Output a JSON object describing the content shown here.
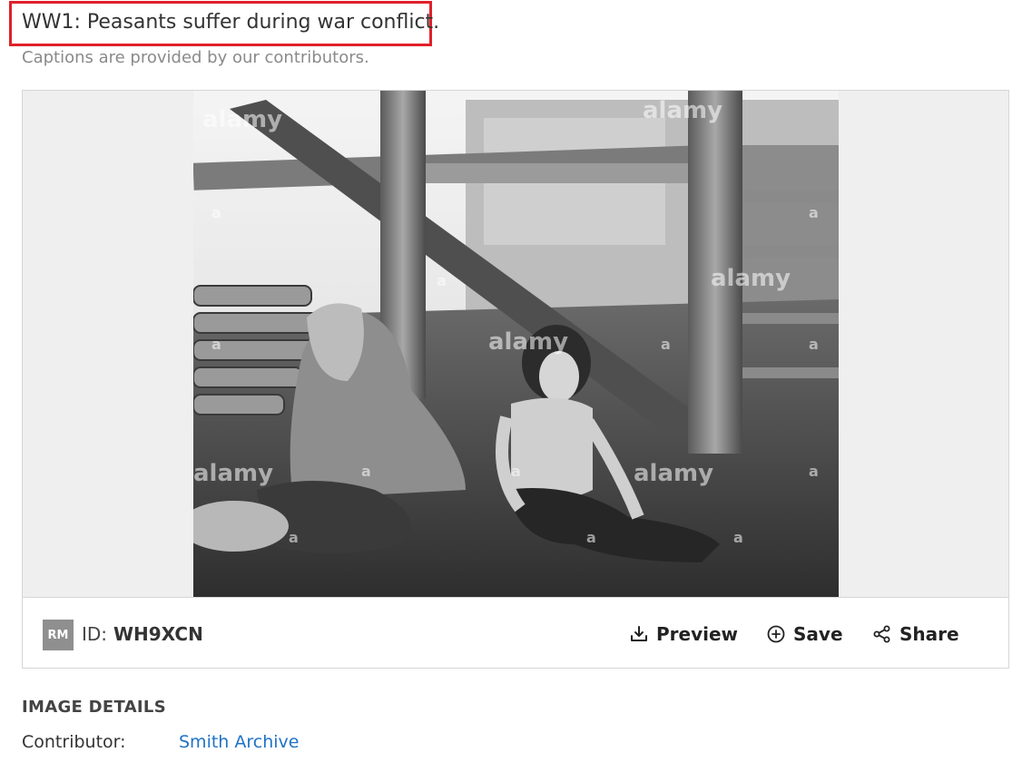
{
  "header": {
    "title": "WW1: Peasants suffer during war conflict.",
    "caption_note": "Captions are provided by our contributors."
  },
  "image": {
    "watermark": "alamy",
    "watermark_mark": "a"
  },
  "toolbar": {
    "license_badge": "RM",
    "id_label": "ID:",
    "id_value": "WH9XCN",
    "preview_label": "Preview",
    "save_label": "Save",
    "share_label": "Share"
  },
  "details": {
    "heading": "IMAGE DETAILS",
    "contributor_label": "Contributor:",
    "contributor_value": "Smith Archive"
  },
  "colors": {
    "highlight_border": "#e0202a",
    "link": "#1f73c6",
    "badge": "#8f8f8f"
  },
  "icons": {
    "preview": "download-icon",
    "save": "plus-circle-icon",
    "share": "share-icon"
  }
}
